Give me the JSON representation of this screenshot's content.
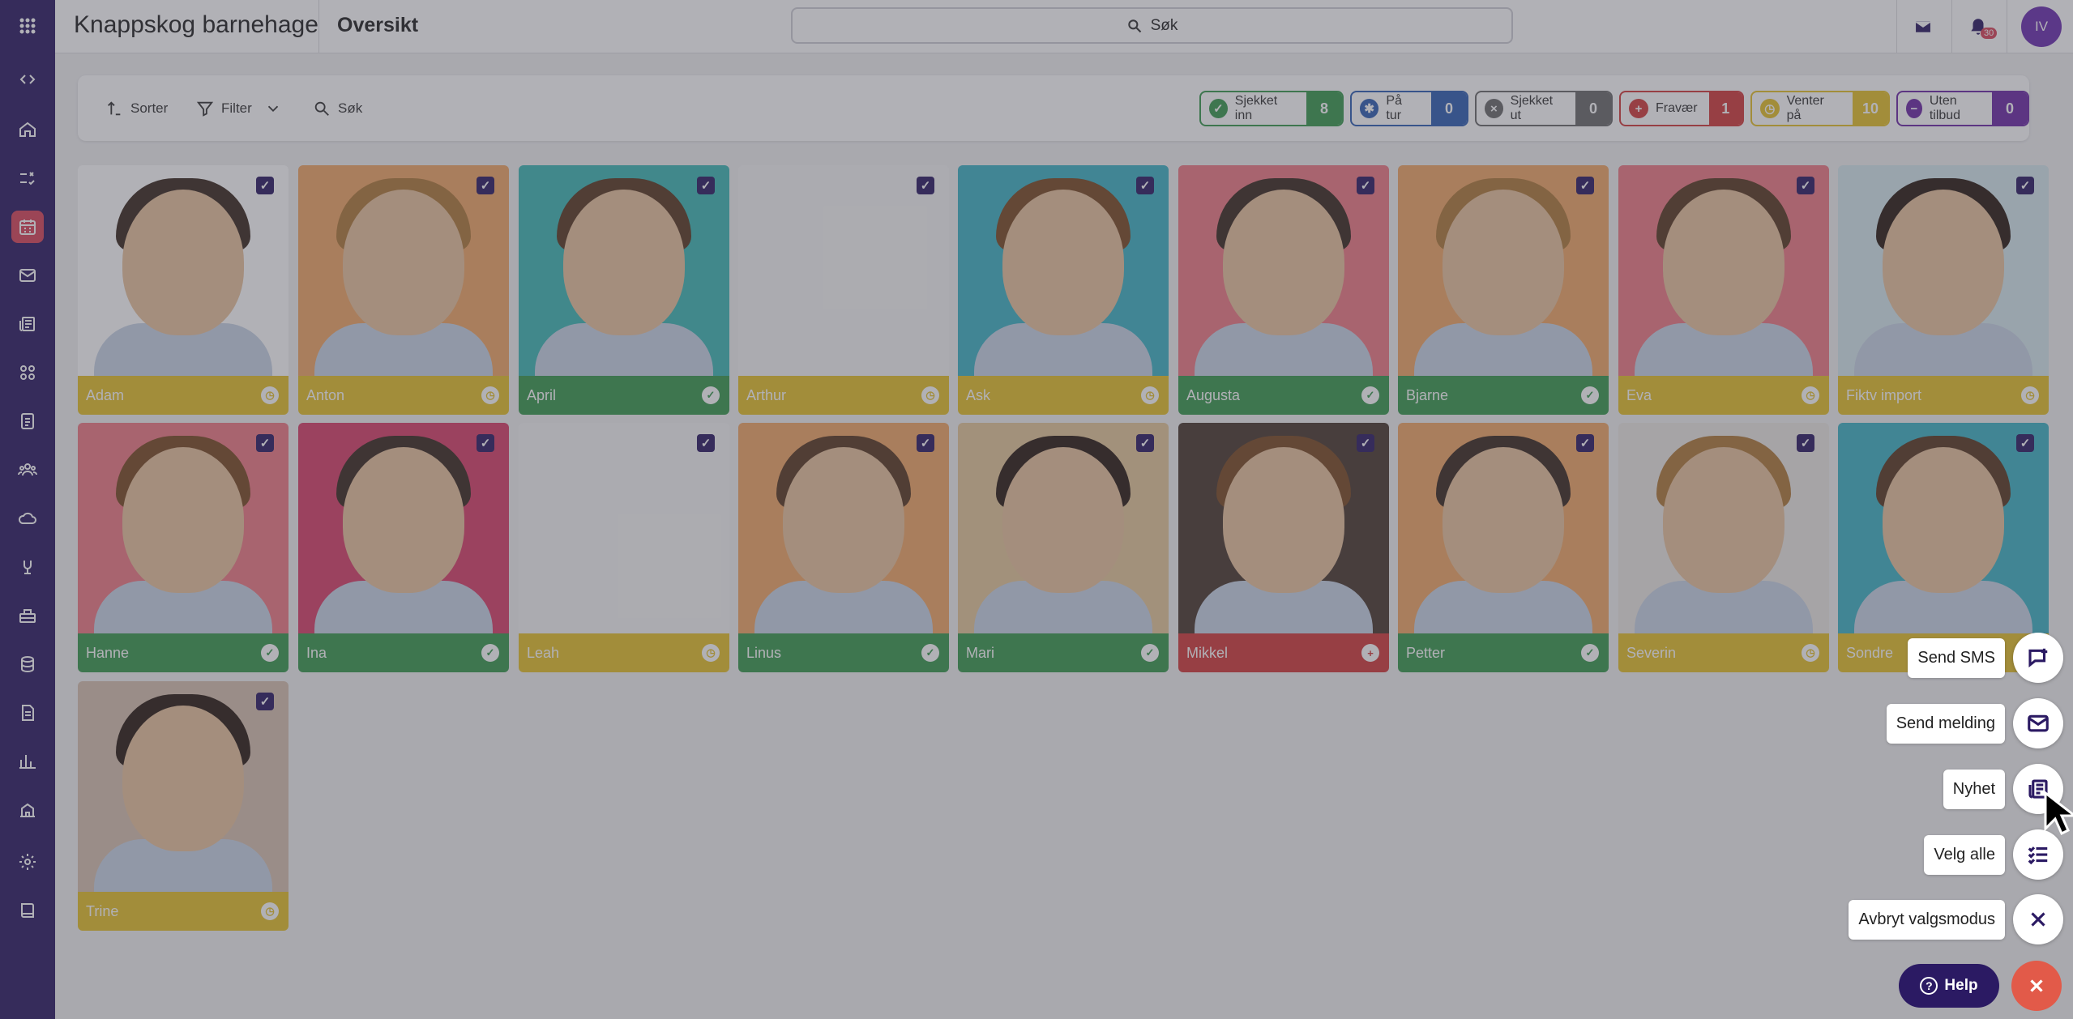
{
  "org_name": "Knappskog barnehage",
  "page_title": "Oversikt",
  "search": {
    "label": "Søk"
  },
  "user": {
    "initials": "IV",
    "notifications": "30"
  },
  "toolbar": {
    "sort": "Sorter",
    "filter": "Filter",
    "search": "Søk"
  },
  "statuses": [
    {
      "label": "Sjekket inn",
      "count": "8",
      "color": "#3a9a4f",
      "icon": "check-circle-icon"
    },
    {
      "label": "På tur",
      "count": "0",
      "color": "#2f5fb3",
      "icon": "walking-icon"
    },
    {
      "label": "Sjekket ut",
      "count": "0",
      "color": "#6b6b6b",
      "icon": "x-circle-icon"
    },
    {
      "label": "Fravær",
      "count": "1",
      "color": "#d33b3b",
      "icon": "plus-circle-icon"
    },
    {
      "label": "Venter på",
      "count": "10",
      "color": "#e6c12a",
      "icon": "clock-icon"
    },
    {
      "label": "Uten tilbud",
      "count": "0",
      "color": "#6d2aa6",
      "icon": "minus-circle-icon"
    }
  ],
  "children": [
    {
      "name": "Adam",
      "status": "waiting",
      "bg": "#ffffff"
    },
    {
      "name": "Anton",
      "status": "waiting",
      "bg": "#f2a866"
    },
    {
      "name": "April",
      "status": "checked_in",
      "bg": "#3fb9b6"
    },
    {
      "name": "Arthur",
      "status": "waiting",
      "bg": "#f5f5f5"
    },
    {
      "name": "Ask",
      "status": "waiting",
      "bg": "#3fb3c4"
    },
    {
      "name": "Augusta",
      "status": "checked_in",
      "bg": "#f07b85"
    },
    {
      "name": "Bjarne",
      "status": "checked_in",
      "bg": "#f2a866"
    },
    {
      "name": "Eva",
      "status": "waiting",
      "bg": "#f07b85"
    },
    {
      "name": "Fiktv import",
      "status": "waiting",
      "bg": "#d6e8ee"
    },
    {
      "name": "Hanne",
      "status": "checked_in",
      "bg": "#f07b85"
    },
    {
      "name": "Ina",
      "status": "checked_in",
      "bg": "#d9406a"
    },
    {
      "name": "Leah",
      "status": "waiting",
      "bg": "#f5f5f5"
    },
    {
      "name": "Linus",
      "status": "checked_in",
      "bg": "#f2a866"
    },
    {
      "name": "Mari",
      "status": "checked_in",
      "bg": "#e6c89a"
    },
    {
      "name": "Mikkel",
      "status": "absent",
      "bg": "#4a3a30"
    },
    {
      "name": "Petter",
      "status": "checked_in",
      "bg": "#f2a866"
    },
    {
      "name": "Severin",
      "status": "waiting",
      "bg": "#ece8e4"
    },
    {
      "name": "Sondre",
      "status": "waiting",
      "bg": "#3fb3c4"
    },
    {
      "name": "Trine",
      "status": "waiting",
      "bg": "#d8c2b0"
    }
  ],
  "status_colors": {
    "waiting": "#e6c12a",
    "checked_in": "#3a9a4f",
    "absent": "#d33b3b"
  },
  "actions": [
    {
      "label": "Send SMS",
      "icon": "sms-icon"
    },
    {
      "label": "Send melding",
      "icon": "mail-icon"
    },
    {
      "label": "Nyhet",
      "icon": "news-icon"
    },
    {
      "label": "Velg alle",
      "icon": "list-check-icon"
    },
    {
      "label": "Avbryt valgsmodus",
      "icon": "close-icon"
    }
  ],
  "help": {
    "label": "Help"
  }
}
